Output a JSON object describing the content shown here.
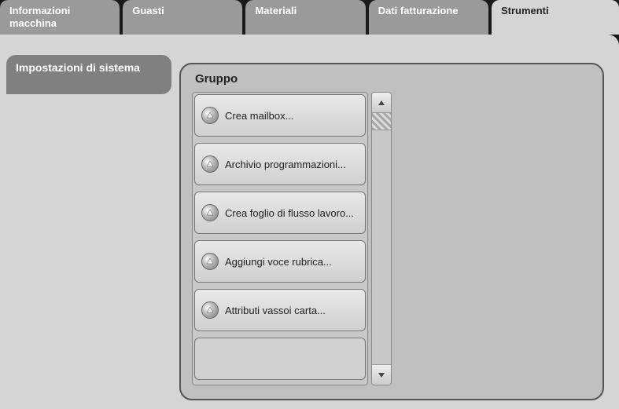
{
  "tabs": [
    {
      "label": "Informazioni macchina"
    },
    {
      "label": "Guasti"
    },
    {
      "label": "Materiali"
    },
    {
      "label": "Dati fatturazione"
    },
    {
      "label": "Strumenti"
    }
  ],
  "active_tab_index": 4,
  "subtab": {
    "label": "Impostazioni di sistema"
  },
  "group": {
    "title": "Gruppo",
    "items": [
      {
        "label": "Crea mailbox..."
      },
      {
        "label": "Archivio programmazioni..."
      },
      {
        "label": "Crea foglio di flusso lavoro..."
      },
      {
        "label": "Aggiungi voce rubrica..."
      },
      {
        "label": "Attributi vassoi carta..."
      },
      {
        "label": ""
      }
    ]
  }
}
